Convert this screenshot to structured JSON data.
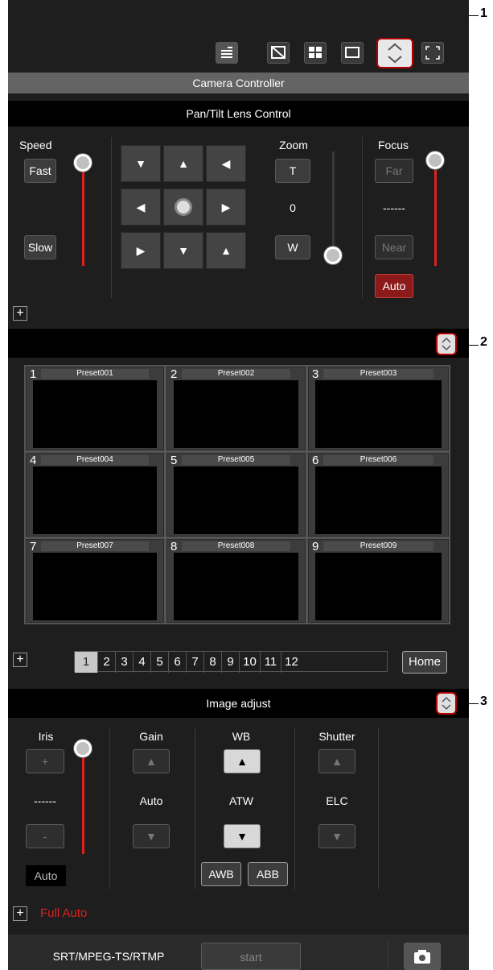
{
  "callouts": [
    "1",
    "2",
    "3"
  ],
  "header": {
    "title": "Camera Controller"
  },
  "pantilt": {
    "title": "Pan/Tilt Lens Control",
    "speed": {
      "label": "Speed",
      "fast": "Fast",
      "slow": "Slow"
    },
    "zoom": {
      "label": "Zoom",
      "tele": "T",
      "wide": "W",
      "value": "0"
    },
    "focus": {
      "label": "Focus",
      "far": "Far",
      "near": "Near",
      "value": "------",
      "auto": "Auto"
    }
  },
  "presets": {
    "items": [
      {
        "num": "1",
        "name": "Preset001"
      },
      {
        "num": "2",
        "name": "Preset002"
      },
      {
        "num": "3",
        "name": "Preset003"
      },
      {
        "num": "4",
        "name": "Preset004"
      },
      {
        "num": "5",
        "name": "Preset005"
      },
      {
        "num": "6",
        "name": "Preset006"
      },
      {
        "num": "7",
        "name": "Preset007"
      },
      {
        "num": "8",
        "name": "Preset008"
      },
      {
        "num": "9",
        "name": "Preset009"
      }
    ],
    "pages": [
      "1",
      "2",
      "3",
      "4",
      "5",
      "6",
      "7",
      "8",
      "9",
      "10",
      "11",
      "12"
    ],
    "active_page": "1",
    "home": "Home"
  },
  "image_adjust": {
    "title": "Image adjust",
    "iris": {
      "label": "Iris",
      "plus": "+",
      "minus": "-",
      "value": "------",
      "auto": "Auto"
    },
    "gain": {
      "label": "Gain",
      "value": "Auto"
    },
    "wb": {
      "label": "WB",
      "value": "ATW",
      "awb": "AWB",
      "abb": "ABB"
    },
    "shutter": {
      "label": "Shutter",
      "value": "ELC"
    },
    "full_auto": "Full Auto"
  },
  "stream": {
    "label": "SRT/MPEG-TS/RTMP",
    "start": "start"
  },
  "colors": {
    "accent_red": "#e02020",
    "active_border": "#b40000"
  }
}
